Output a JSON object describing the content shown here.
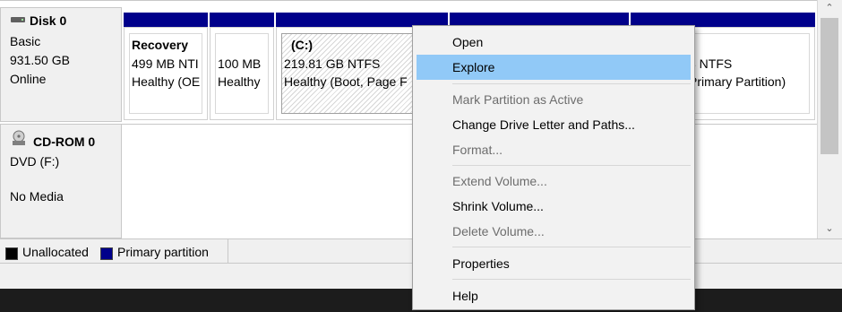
{
  "disks": [
    {
      "title": "Disk 0",
      "lines": [
        "Basic",
        "931.50 GB",
        "Online"
      ]
    },
    {
      "title": "CD-ROM 0",
      "lines": [
        "DVD (F:)",
        "No Media"
      ]
    }
  ],
  "partitions": [
    {
      "name": "Recovery",
      "size": "499 MB NTI",
      "status": "Healthy (OE"
    },
    {
      "name": "",
      "size": "100 MB",
      "status": "Healthy"
    },
    {
      "name": "(C:)",
      "size": "219.81 GB NTFS",
      "status": "Healthy (Boot, Page F"
    },
    {
      "name": "",
      "size": "",
      "status": ""
    },
    {
      "name": "",
      "size": "3 NTFS",
      "status": "Primary Partition)"
    }
  ],
  "legend": {
    "unallocated": "Unallocated",
    "primary": "Primary partition"
  },
  "colors": {
    "primary_partition": "#00008b",
    "unallocated": "#000000",
    "menu_highlight": "#91c9f7"
  },
  "context_menu": {
    "items": [
      {
        "label": "Open",
        "state": "enabled"
      },
      {
        "label": "Explore",
        "state": "highlighted"
      },
      {
        "label": "Mark Partition as Active",
        "state": "disabled"
      },
      {
        "label": "Change Drive Letter and Paths...",
        "state": "enabled"
      },
      {
        "label": "Format...",
        "state": "disabled"
      },
      {
        "label": "Extend Volume...",
        "state": "disabled"
      },
      {
        "label": "Shrink Volume...",
        "state": "enabled"
      },
      {
        "label": "Delete Volume...",
        "state": "disabled"
      },
      {
        "label": "Properties",
        "state": "enabled"
      },
      {
        "label": "Help",
        "state": "enabled"
      }
    ]
  },
  "icons": {
    "scroll_up": "chevron-up-icon",
    "scroll_down": "chevron-down-icon",
    "disk": "hard-disk-icon",
    "cdrom": "cd-rom-icon"
  }
}
